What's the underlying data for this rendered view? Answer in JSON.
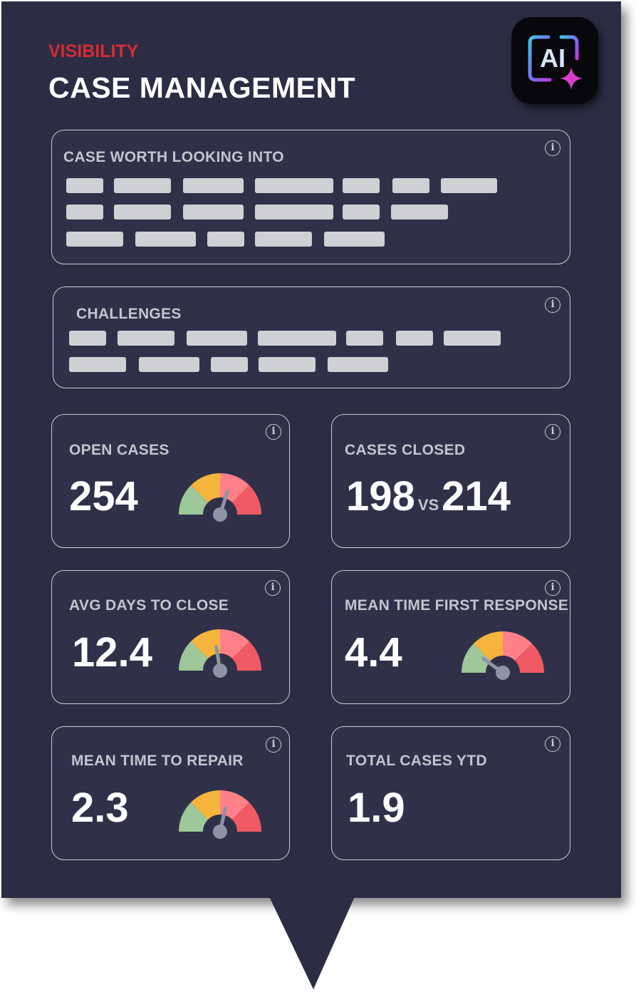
{
  "header": {
    "eyebrow": "VISIBILITY",
    "title": "CASE MANAGEMENT",
    "badge_label": "AI"
  },
  "cards": {
    "case_worth": {
      "title": "CASE WORTH LOOKING INTO",
      "info_glyph": "i"
    },
    "challenges": {
      "title": "CHALLENGES",
      "info_glyph": "i"
    },
    "open_cases": {
      "title": "OPEN CASES",
      "value": "254",
      "info_glyph": "i",
      "gauge_level": 0.6
    },
    "cases_closed": {
      "title": "CASES CLOSED",
      "value": "198",
      "vs": "VS",
      "compare_value": "214",
      "info_glyph": "i"
    },
    "avg_days": {
      "title": "AVG DAYS TO CLOSE",
      "value": "12.4",
      "info_glyph": "i",
      "gauge_level": 0.45
    },
    "mean_first_response": {
      "title": "MEAN TIME FIRST RESPONSE",
      "value": "4.4",
      "info_glyph": "i",
      "gauge_level": 0.2
    },
    "mean_repair": {
      "title": "MEAN TIME TO REPAIR",
      "value": "2.3",
      "info_glyph": "i",
      "gauge_level": 0.57
    },
    "total_ytd": {
      "title": "TOTAL CASES YTD",
      "value": "1.9",
      "info_glyph": "i"
    }
  },
  "colors": {
    "panel": "#2c2d44",
    "accent_red": "#d72b34",
    "gauge_green": "#9ec79a",
    "gauge_yellow": "#f5b53d",
    "gauge_pink": "#ff8088",
    "gauge_red": "#f05a64",
    "needle": "#8e94a3"
  },
  "icons": {
    "ai_badge": "ai-sparkle-icon",
    "info": "info-icon"
  }
}
